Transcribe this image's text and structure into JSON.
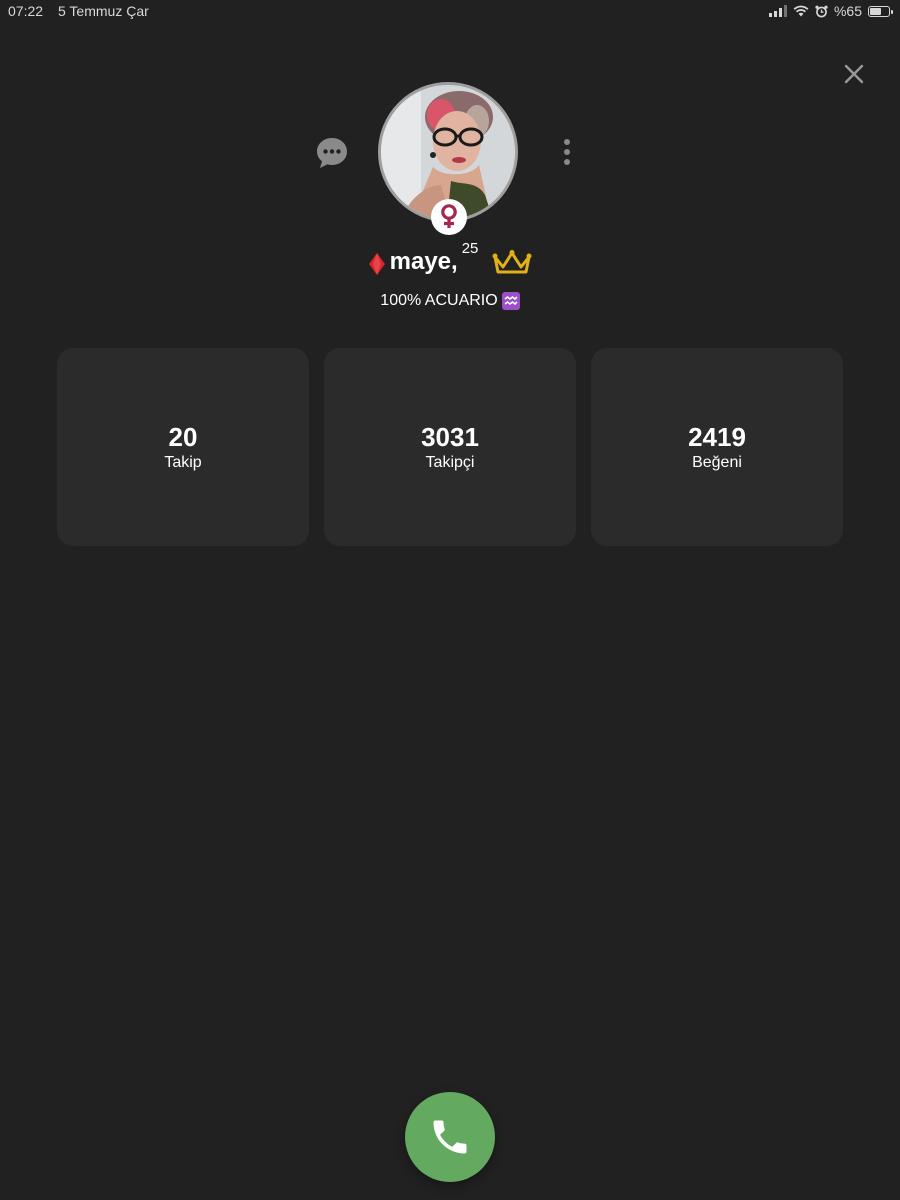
{
  "status_bar": {
    "time": "07:22",
    "date": "5 Temmuz Çar",
    "battery": "%65",
    "battery_level": 0.65
  },
  "profile": {
    "username": "maye,",
    "age": "25",
    "bio": "100% ACUARIO",
    "badge_icons": [
      "diamond-icon",
      "crown-icon",
      "female-icon",
      "aquarius-icon"
    ]
  },
  "stats": [
    {
      "value": "20",
      "label": "Takip"
    },
    {
      "value": "3031",
      "label": "Takipçi"
    },
    {
      "value": "2419",
      "label": "Beğeni"
    }
  ],
  "colors": {
    "background": "#212121",
    "card": "#2b2b2b",
    "call_button": "#63a95f",
    "gender_badge": "#a3284d",
    "crown": "#e2b019",
    "diamond": "#d9232a"
  }
}
